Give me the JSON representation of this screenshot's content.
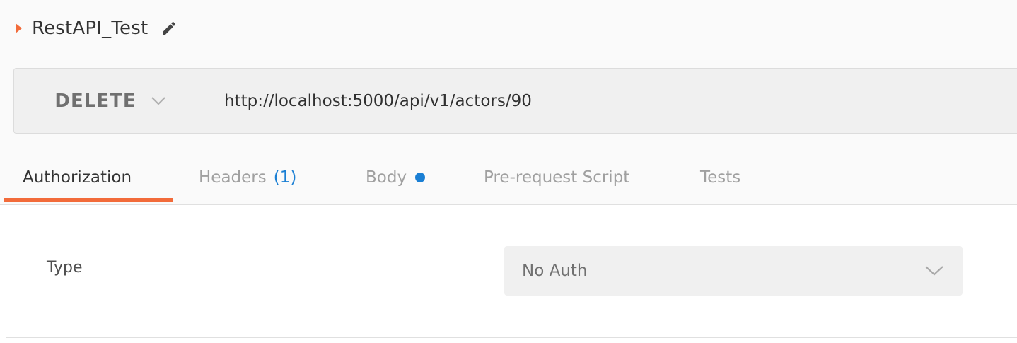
{
  "request": {
    "name": "RestAPI_Test",
    "method": "DELETE",
    "url": "http://localhost:5000/api/v1/actors/90"
  },
  "tabs": [
    {
      "label": "Authorization",
      "active": true
    },
    {
      "label": "Headers",
      "count": "(1)"
    },
    {
      "label": "Body",
      "indicator": "dot"
    },
    {
      "label": "Pre-request Script"
    },
    {
      "label": "Tests"
    }
  ],
  "auth": {
    "type_label": "Type",
    "selected": "No Auth"
  },
  "icons": {
    "collapse": "caret-right-icon",
    "edit": "pencil-icon",
    "method_dropdown": "chevron-down-icon",
    "auth_dropdown": "chevron-down-icon"
  },
  "colors": {
    "accent": "#f26b3a",
    "link": "#1a7fd4"
  }
}
